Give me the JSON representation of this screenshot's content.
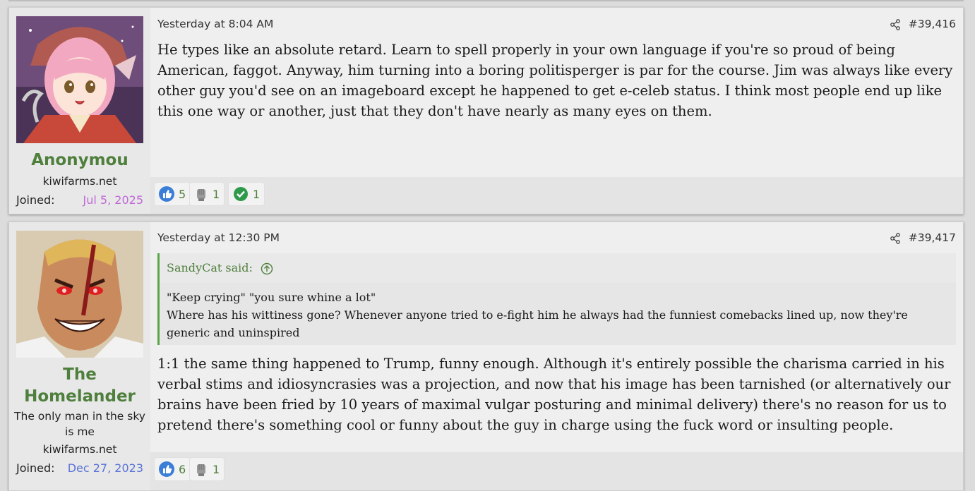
{
  "posts": [
    {
      "user": {
        "name": "Anonymou",
        "site": "kiwifarms.net",
        "joined_label": "Joined:",
        "joined_date": "Jul 5, 2025",
        "joined_color": "#c06ad8",
        "avatar_icon": "anime-girl-avatar-icon"
      },
      "date": "Yesterday at 8:04 AM",
      "post_number": "#39,416",
      "body": "He types like an absolute retard. Learn to spell properly in your own language if you're so proud of being American, faggot. Anyway, him turning into a boring politisperger is par for the course. Jim was always like every other guy you'd see on an imageboard except he happened to get e-celeb status. I think most people end up like this one way or another, just that they don't have nearly as many eyes on them.",
      "reactions": [
        {
          "icon": "thumbs-up-icon",
          "count": "5"
        },
        {
          "icon": "fist-icon",
          "count": "1"
        },
        {
          "icon": "checkmark-icon",
          "count": "1"
        }
      ]
    },
    {
      "user": {
        "name": "The Homelander",
        "title": "The only man in the sky is me",
        "site": "kiwifarms.net",
        "joined_label": "Joined:",
        "joined_date": "Dec 27, 2023",
        "joined_color": "#5a74d8",
        "avatar_icon": "villain-face-avatar-icon"
      },
      "date": "Yesterday at 12:30 PM",
      "post_number": "#39,417",
      "quote": {
        "author": "SandyCat said:",
        "lines": [
          "\"Keep crying\" \"you sure whine a lot\"",
          "Where has his wittiness gone? Whenever anyone tried to e-fight him he always had the funniest comebacks lined up, now they're generic and uninspired"
        ]
      },
      "body": "1:1 the same thing happened to Trump, funny enough. Although it's entirely possible the charisma carried in his verbal stims and idiosyncrasies was a projection, and now that his image has been tarnished (or alternatively our brains have been fried by 10 years of maximal vulgar posturing and minimal delivery) there's no reason for us to pretend there's something cool or funny about the guy in charge using the fuck word or insulting people.",
      "reactions": [
        {
          "icon": "thumbs-up-icon",
          "count": "6"
        },
        {
          "icon": "fist-icon",
          "count": "1"
        }
      ]
    }
  ],
  "colors": {
    "username": "#4f7f3c",
    "quote_border": "#58a54a",
    "post_bg": "#efefef",
    "user_bg": "#e8e8e8"
  }
}
